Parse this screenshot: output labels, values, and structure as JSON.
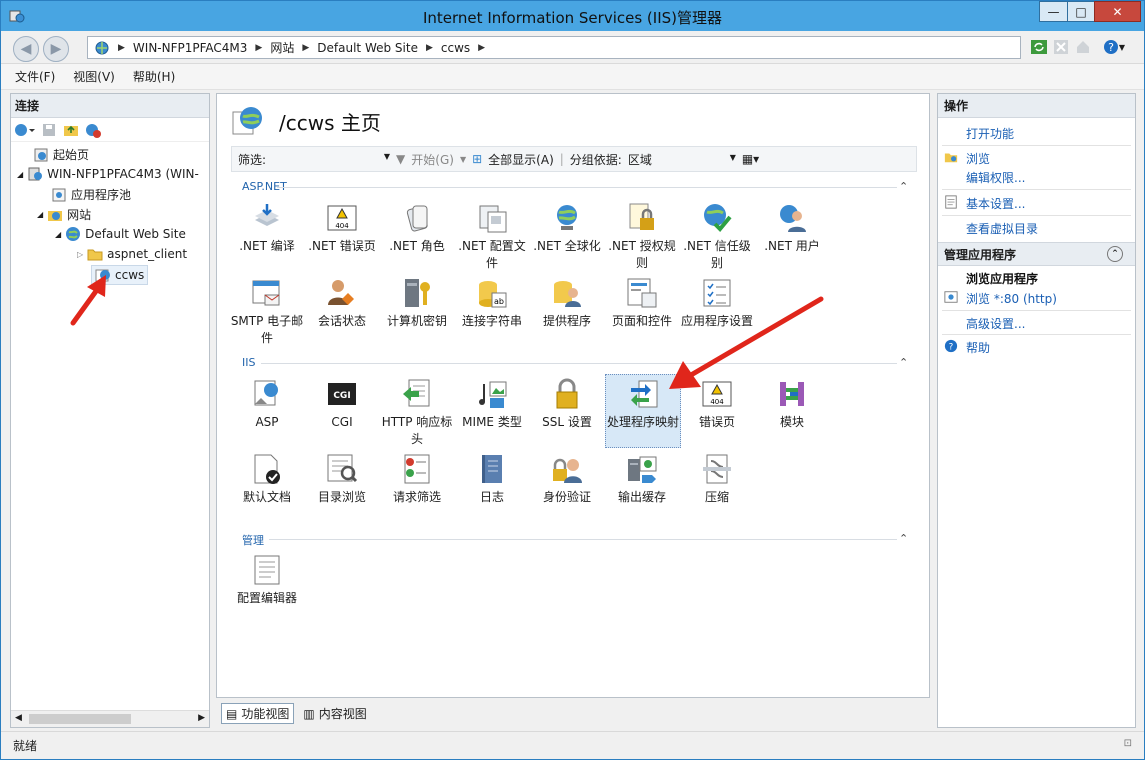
{
  "window": {
    "title": "Internet Information Services (IIS)管理器",
    "buttons": {
      "minimize": "—",
      "maximize": "□",
      "close": "✕"
    }
  },
  "address": {
    "crumbs": [
      "WIN-NFP1PFAC4M3",
      "网站",
      "Default Web Site",
      "ccws"
    ]
  },
  "menu": [
    "文件(F)",
    "视图(V)",
    "帮助(H)"
  ],
  "connections": {
    "header": "连接",
    "tree": {
      "start": "起始页",
      "server": "WIN-NFP1PFAC4M3 (WIN-",
      "app_pools": "应用程序池",
      "sites": "网站",
      "default_site": "Default Web Site",
      "aspnet_client": "aspnet_client",
      "ccws": "ccws"
    }
  },
  "content": {
    "title": "/ccws 主页",
    "filter": {
      "label": "筛选:",
      "go": "开始(G)",
      "show_all": "全部显示(A)",
      "group_by_label": "分组依据:",
      "group_by_value": "区域"
    },
    "groups": [
      {
        "title": "ASP.NET",
        "items": [
          ".NET 编译",
          ".NET 错误页",
          ".NET 角色",
          ".NET 配置文件",
          ".NET 全球化",
          ".NET 授权规则",
          ".NET 信任级别",
          ".NET 用户",
          "SMTP 电子邮件",
          "会话状态",
          "计算机密钥",
          "连接字符串",
          "提供程序",
          "页面和控件",
          "应用程序设置"
        ]
      },
      {
        "title": "IIS",
        "items": [
          "ASP",
          "CGI",
          "HTTP 响应标头",
          "MIME 类型",
          "SSL 设置",
          "处理程序映射",
          "错误页",
          "模块",
          "默认文档",
          "目录浏览",
          "请求筛选",
          "日志",
          "身份验证",
          "输出缓存",
          "压缩"
        ]
      },
      {
        "title": "管理",
        "items": [
          "配置编辑器"
        ]
      }
    ],
    "cgi_icon_text": "CGI",
    "err_icon_text": "404"
  },
  "views": {
    "features": "功能视图",
    "content": "内容视图"
  },
  "actions": {
    "header": "操作",
    "open_feature": "打开功能",
    "browse": "浏览",
    "edit_permissions": "编辑权限...",
    "basic_settings": "基本设置...",
    "view_virtual_dirs": "查看虚拟目录",
    "manage_app_header": "管理应用程序",
    "browse_app_header": "浏览应用程序",
    "browse_port": "浏览 *:80 (http)",
    "advanced_settings": "高级设置...",
    "help": "帮助"
  },
  "status": {
    "text": "就绪"
  }
}
